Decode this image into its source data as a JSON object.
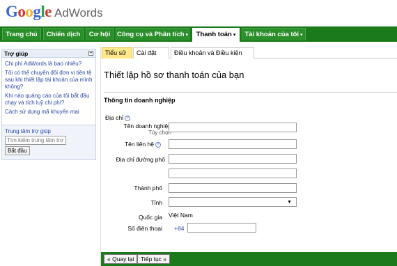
{
  "app": {
    "logo_google": "Google",
    "logo_product": "AdWords"
  },
  "nav": {
    "tabs": [
      {
        "label": "Trang chủ"
      },
      {
        "label": "Chiến dịch"
      },
      {
        "label": "Cơ hội"
      },
      {
        "label": "Công cụ và Phân tích",
        "caret": "▾"
      },
      {
        "label": "Thanh toán",
        "caret": "▾"
      },
      {
        "label": "Tài khoản của tôi",
        "caret": "▾"
      }
    ]
  },
  "sidebar": {
    "title": "Trợ giúp",
    "minimize": "–",
    "links": [
      "Chi phí AdWords là bao nhiêu?",
      "Tôi có thể chuyển đổi đơn vị tiền tệ sau khi thiết lập tài khoản của mình không?",
      "Khi nào quảng cáo của tôi bắt đầu chạy và tích luỹ chi phí?",
      "Cách sử dụng mã khuyến mại"
    ],
    "help_center_label": "Trung tâm trợ giúp",
    "search_placeholder": "Tìm kiếm trung tâm trợ",
    "search_button": "Bắt đầu"
  },
  "subtabs": [
    "Tiểu sử",
    "Cài đặt",
    "Điều khoản và Điều kiện"
  ],
  "page_title": "Thiết lập hồ sơ thanh toán của bạn",
  "section_title": "Thông tin doanh nghiệp",
  "form": {
    "address_label": "Địa chỉ",
    "business_name_label": "Tên doanh nghiệp",
    "business_name_sub": "Tùy chọn",
    "contact_name_label": "Tên liên hệ",
    "street_label": "Địa chỉ đường phố",
    "city_label": "Thành phố",
    "province_label": "Tỉnh",
    "country_label": "Quốc gia",
    "country_value": "Việt Nam",
    "phone_label": "Số điện thoại",
    "phone_prefix": "+84",
    "help": "?",
    "dropdown_arrow": "▼"
  },
  "footer": {
    "back_button": "« Quay lại",
    "continue_button": "Tiếp tục »"
  }
}
